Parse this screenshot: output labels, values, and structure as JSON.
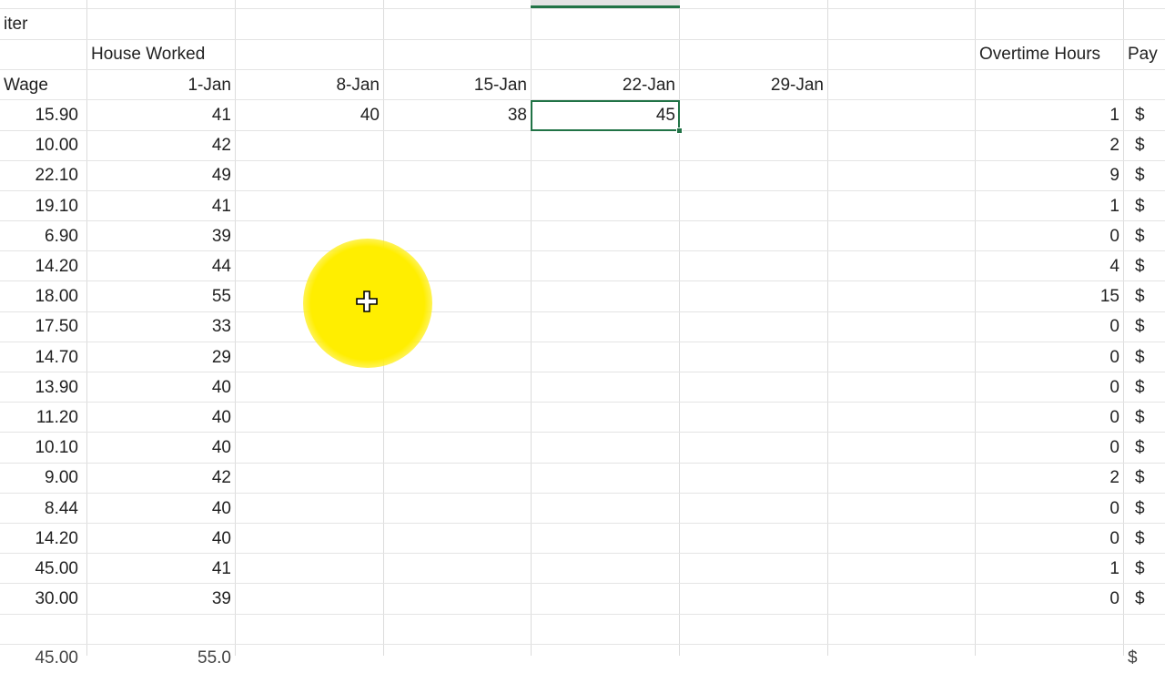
{
  "sheet": {
    "top_label": "iter",
    "header_group": "House Worked",
    "overtime_header": "Overtime Hours",
    "pay_header": "Pay",
    "wage_header": "Wage",
    "week_headers": [
      "1-Jan",
      "8-Jan",
      "15-Jan",
      "22-Jan",
      "29-Jan"
    ],
    "rows": [
      {
        "wage": "15.90",
        "jan1": "41",
        "jan8": "40",
        "jan15": "38",
        "jan22": "45",
        "overtime": "1",
        "pay": "$"
      },
      {
        "wage": "10.00",
        "jan1": "42",
        "jan8": "",
        "jan15": "",
        "jan22": "",
        "overtime": "2",
        "pay": "$"
      },
      {
        "wage": "22.10",
        "jan1": "49",
        "jan8": "",
        "jan15": "",
        "jan22": "",
        "overtime": "9",
        "pay": "$"
      },
      {
        "wage": "19.10",
        "jan1": "41",
        "jan8": "",
        "jan15": "",
        "jan22": "",
        "overtime": "1",
        "pay": "$"
      },
      {
        "wage": "6.90",
        "jan1": "39",
        "jan8": "",
        "jan15": "",
        "jan22": "",
        "overtime": "0",
        "pay": "$"
      },
      {
        "wage": "14.20",
        "jan1": "44",
        "jan8": "",
        "jan15": "",
        "jan22": "",
        "overtime": "4",
        "pay": "$"
      },
      {
        "wage": "18.00",
        "jan1": "55",
        "jan8": "",
        "jan15": "",
        "jan22": "",
        "overtime": "15",
        "pay": "$"
      },
      {
        "wage": "17.50",
        "jan1": "33",
        "jan8": "",
        "jan15": "",
        "jan22": "",
        "overtime": "0",
        "pay": "$"
      },
      {
        "wage": "14.70",
        "jan1": "29",
        "jan8": "",
        "jan15": "",
        "jan22": "",
        "overtime": "0",
        "pay": "$"
      },
      {
        "wage": "13.90",
        "jan1": "40",
        "jan8": "",
        "jan15": "",
        "jan22": "",
        "overtime": "0",
        "pay": "$"
      },
      {
        "wage": "11.20",
        "jan1": "40",
        "jan8": "",
        "jan15": "",
        "jan22": "",
        "overtime": "0",
        "pay": "$"
      },
      {
        "wage": "10.10",
        "jan1": "40",
        "jan8": "",
        "jan15": "",
        "jan22": "",
        "overtime": "0",
        "pay": "$"
      },
      {
        "wage": "9.00",
        "jan1": "42",
        "jan8": "",
        "jan15": "",
        "jan22": "",
        "overtime": "2",
        "pay": "$"
      },
      {
        "wage": "8.44",
        "jan1": "40",
        "jan8": "",
        "jan15": "",
        "jan22": "",
        "overtime": "0",
        "pay": "$"
      },
      {
        "wage": "14.20",
        "jan1": "40",
        "jan8": "",
        "jan15": "",
        "jan22": "",
        "overtime": "0",
        "pay": "$"
      },
      {
        "wage": "45.00",
        "jan1": "41",
        "jan8": "",
        "jan15": "",
        "jan22": "",
        "overtime": "1",
        "pay": "$"
      },
      {
        "wage": "30.00",
        "jan1": "39",
        "jan8": "",
        "jan15": "",
        "jan22": "",
        "overtime": "0",
        "pay": "$"
      }
    ],
    "selected_cell_value": "45",
    "cursor_icon": "move-crosshair-icon",
    "selection_color": "#217346",
    "cursor_highlight_color": "#FFEE00"
  }
}
